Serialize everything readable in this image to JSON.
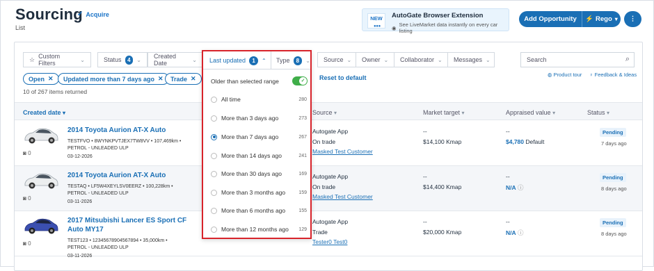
{
  "header": {
    "title": "Sourcing",
    "verified_label": "Acquire",
    "subtitle": "List"
  },
  "extension": {
    "badge": "NEW",
    "title": "AutoGate Browser Extension",
    "description": "See LiveMarket data instantly on every car listing"
  },
  "actions": {
    "add_opportunity": "Add Opportunity",
    "rego": "Rego",
    "more": "⋮"
  },
  "filters": {
    "custom_filters": "Custom Filters",
    "status": "Status",
    "status_count": "4",
    "created_date": "Created Date",
    "last_updated": "Last updated",
    "last_updated_count": "1",
    "type": "Type",
    "type_count": "8",
    "source": "Source",
    "owner": "Owner",
    "collaborator": "Collaborator",
    "messages": "Messages",
    "search_placeholder": "Search",
    "product_tour": "Product tour",
    "feedback": "Feedback & Ideas"
  },
  "chips": [
    "Open",
    "Updated more than 7 days ago",
    "Trade"
  ],
  "results": {
    "count_text": "10 of 267 items returned"
  },
  "dropdown": {
    "older_label": "Older than selected range",
    "reset": "Reset to default",
    "options": [
      {
        "label": "All time",
        "count": "280",
        "selected": false
      },
      {
        "label": "More than 3 days ago",
        "count": "273",
        "selected": false
      },
      {
        "label": "More than 7 days ago",
        "count": "267",
        "selected": true
      },
      {
        "label": "More than 14 days ago",
        "count": "241",
        "selected": false
      },
      {
        "label": "More than 30 days ago",
        "count": "169",
        "selected": false
      },
      {
        "label": "More than 3 months ago",
        "count": "159",
        "selected": false
      },
      {
        "label": "More than 6 months ago",
        "count": "155",
        "selected": false
      },
      {
        "label": "More than 12 months ago",
        "count": "129",
        "selected": false
      }
    ]
  },
  "table": {
    "headers": {
      "created": "Created date",
      "source": "Source",
      "market": "Market target",
      "appraised": "Appraised value",
      "status": "Status"
    },
    "rows": [
      {
        "title": "2014 Toyota Aurion AT-X Auto",
        "line1": "TESTFVO • 8WYNKPVTJEX7TW8VV • 107,469km •",
        "line2": "PETROL - UNLEADED ULP",
        "date": "03-12-2026",
        "photos": "0",
        "source1": "Autogate App",
        "source2": "On trade",
        "source_link": "Masked Test Customer",
        "market1": "--",
        "market2": "$14,100 Kmap",
        "appraised1": "--",
        "appraised_value": "$4,780",
        "appraised_suffix": "Default",
        "status": "Pending",
        "days": "7 days ago"
      },
      {
        "title": "2014 Toyota Aurion AT-X Auto",
        "line1": "TESTAQ • LF5W4XEYLSV0EERZ • 100,228km •",
        "line2": "PETROL - UNLEADED ULP",
        "date": "03-11-2026",
        "photos": "0",
        "source1": "Autogate App",
        "source2": "On trade",
        "source_link": "Masked Test Customer",
        "market1": "--",
        "market2": "$14,400 Kmap",
        "appraised1": "--",
        "appraised_value": "N/A",
        "appraised_suffix": "",
        "status": "Pending",
        "days": "8 days ago"
      },
      {
        "title": "2017 Mitsubishi Lancer ES Sport CF Auto MY17",
        "line1": "TEST123 • 12345678904567894 • 35,000km •",
        "line2": "PETROL - UNLEADED ULP",
        "date": "03-11-2026",
        "photos": "0",
        "source1": "Autogate App",
        "source2": "Trade",
        "source_link": "Tester0 Test0",
        "market1": "--",
        "market2": "$20,000 Kmap",
        "appraised1": "--",
        "appraised_value": "N/A",
        "appraised_suffix": "",
        "status": "Pending",
        "days": "8 days ago"
      }
    ]
  },
  "colors": {
    "accent": "#1a6fb5",
    "highlight": "#d8232a",
    "toggle": "#3fae49"
  }
}
